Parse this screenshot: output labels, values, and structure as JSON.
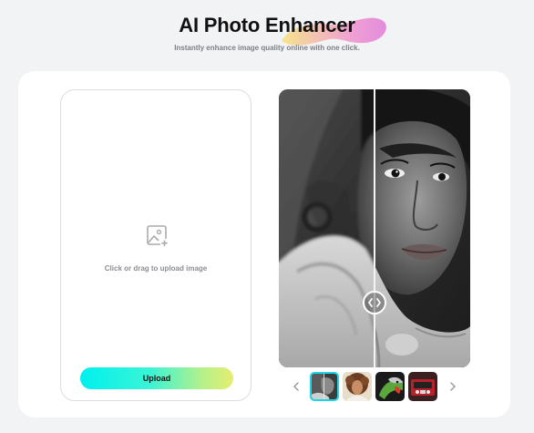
{
  "header": {
    "title": "AI Photo Enhancer",
    "subtitle": "Instantly enhance image quality online with one click."
  },
  "upload": {
    "hint": "Click or drag to upload image",
    "button_label": "Upload",
    "icon": "image-add-icon"
  },
  "preview": {
    "description_icon": "compare-slider-handle-icon",
    "thumbnails": [
      {
        "name": "woman-portrait",
        "selected": true
      },
      {
        "name": "curly-hair-portrait",
        "selected": false
      },
      {
        "name": "parrot",
        "selected": false
      },
      {
        "name": "red-vehicle",
        "selected": false
      }
    ],
    "prev_icon": "chevron-left-icon",
    "next_icon": "chevron-right-icon"
  },
  "colors": {
    "page_background": "#f2f3f5",
    "card_background": "#ffffff",
    "upload_gradient_start": "#00f0ee",
    "upload_gradient_end": "#e4ee70",
    "selected_thumb_border": "#19d7e8"
  }
}
